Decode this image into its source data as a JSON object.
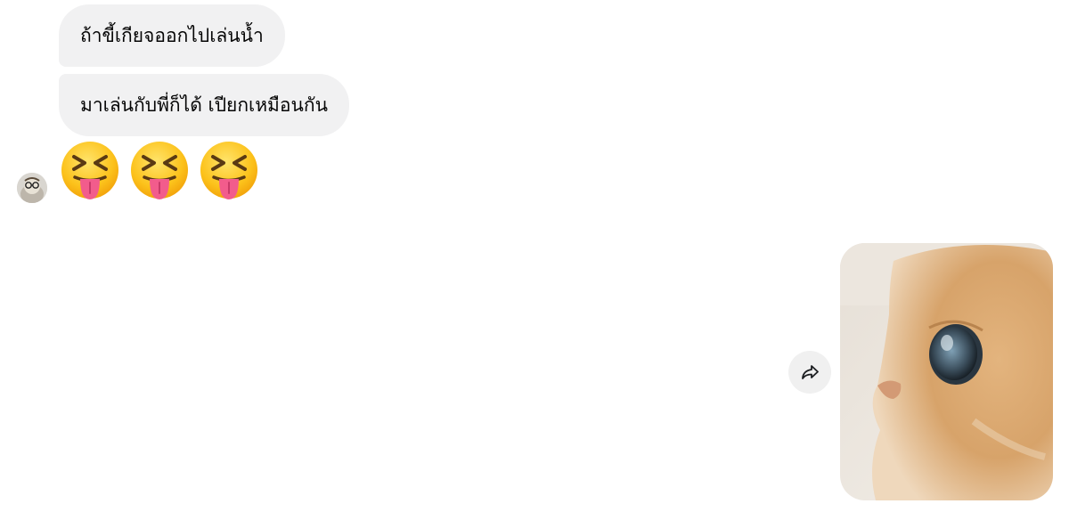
{
  "messages": [
    {
      "text": "ถ้าขี้เกียจออกไปเล่นน้ำ"
    },
    {
      "text": "มาเล่นกับพี่ก็ได้ เปียกเหมือนกัน"
    }
  ],
  "reaction_emojis": [
    "😝",
    "😝",
    "😝"
  ],
  "icons": {
    "avatar": "contact-avatar",
    "share": "share-arrow-icon",
    "photo": "cat-photo"
  },
  "colors": {
    "bubble": "#f1f1f2",
    "text": "#050505",
    "share_bg": "#f0f0f0"
  }
}
